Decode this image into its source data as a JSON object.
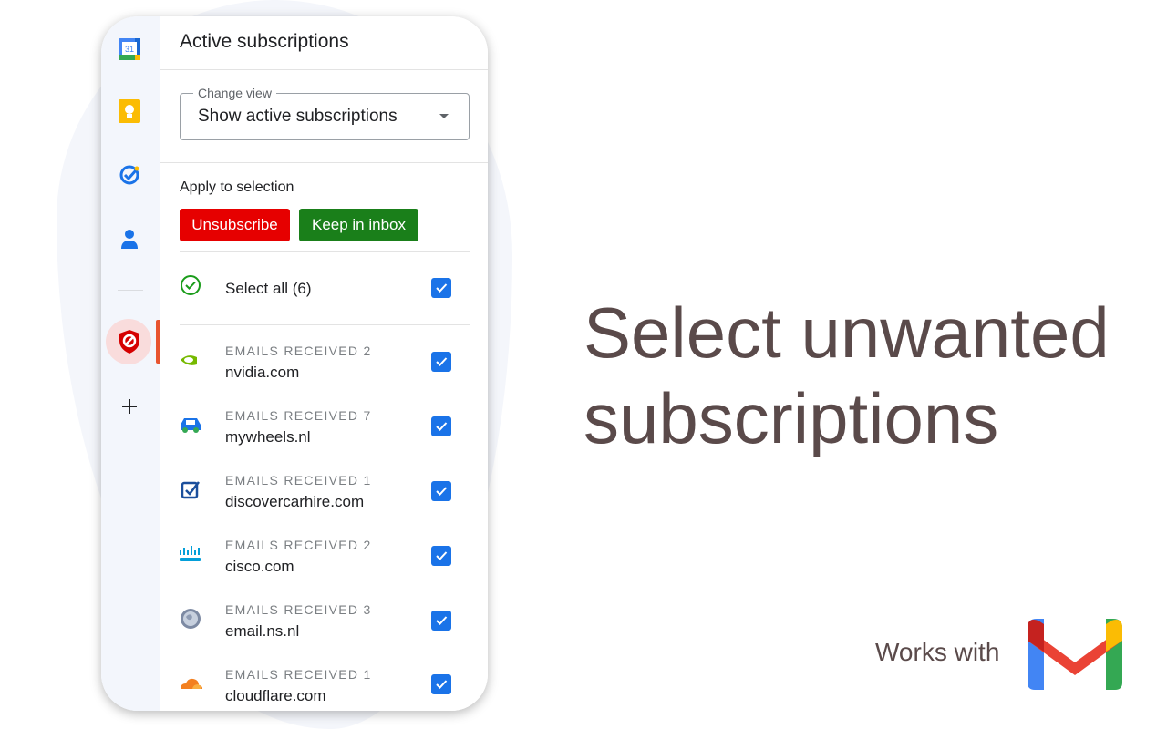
{
  "sidebar": {
    "icons": [
      "calendar-icon",
      "keep-notes-icon",
      "tasks-icon",
      "contacts-icon",
      "subscription-shield-icon",
      "add-icon"
    ],
    "calendar_day": "31"
  },
  "panel": {
    "title": "Active subscriptions",
    "change_view": {
      "legend": "Change view",
      "value": "Show active subscriptions"
    },
    "apply_label": "Apply to selection",
    "buttons": {
      "unsubscribe": "Unsubscribe",
      "keep": "Keep in inbox"
    },
    "select_all": "Select all (6)",
    "subscriptions": [
      {
        "meta": "EMAILS RECEIVED 2",
        "domain": "nvidia.com",
        "icon": "nvidia-logo-icon",
        "checked": true
      },
      {
        "meta": "EMAILS RECEIVED 7",
        "domain": "mywheels.nl",
        "icon": "car-icon",
        "checked": true
      },
      {
        "meta": "EMAILS RECEIVED 1",
        "domain": "discovercarhire.com",
        "icon": "check-square-icon",
        "checked": true
      },
      {
        "meta": "EMAILS RECEIVED 2",
        "domain": "cisco.com",
        "icon": "cisco-logo-icon",
        "checked": true
      },
      {
        "meta": "EMAILS RECEIVED 3",
        "domain": "email.ns.nl",
        "icon": "globe-icon",
        "checked": true
      },
      {
        "meta": "EMAILS RECEIVED 1",
        "domain": "cloudflare.com",
        "icon": "cloud-icon",
        "checked": true
      }
    ]
  },
  "promo": {
    "headline_line1": "Select unwanted",
    "headline_line2": "subscriptions",
    "works_with": "Works with"
  },
  "colors": {
    "unsubscribe": "#e60000",
    "keep": "#1a7f1a",
    "checkbox": "#1a73e8",
    "headline": "#5a4a4a"
  }
}
